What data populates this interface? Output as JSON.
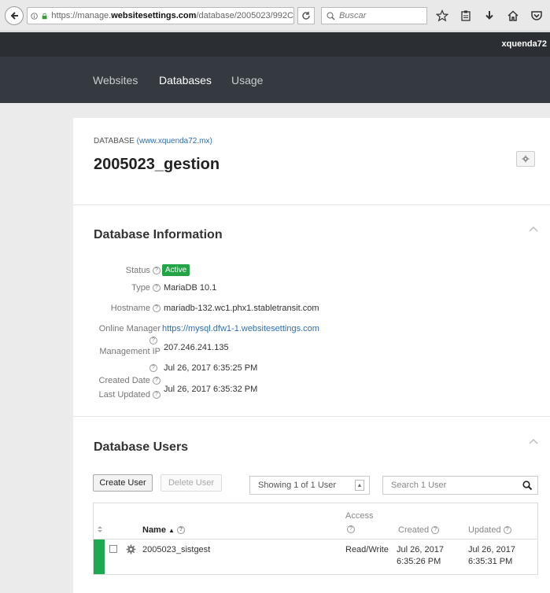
{
  "browser": {
    "url_prefix": "https://manage.",
    "url_domain": "websitesettings.com",
    "url_suffix": "/database/2005023/992C",
    "search_placeholder": "Buscar"
  },
  "header": {
    "username": "xquenda72",
    "nav": [
      "Websites",
      "Databases",
      "Usage"
    ],
    "active_nav": "Databases"
  },
  "database": {
    "eyebrow_label": "DATABASE",
    "eyebrow_domain": "(www.xquenda72.mx)",
    "name": "2005023_gestion"
  },
  "info": {
    "title": "Database Information",
    "status_label": "Status",
    "status_value": "Active",
    "type_label": "Type",
    "type_value": "MariaDB 10.1",
    "hostname_label": "Hostname",
    "hostname_value": "mariadb-132.wc1.phx1.stabletransit.com",
    "online_manager_label": "Online Manager",
    "online_manager_value": "https://mysql.dfw1-1.websitesettings.com",
    "management_ip_label": "Management IP",
    "management_ip_value": "207.246.241.135",
    "created_label": "Created Date",
    "created_value": "Jul 26, 2017 6:35:25 PM",
    "updated_label": "Last Updated",
    "updated_value": "Jul 26, 2017 6:35:32 PM"
  },
  "users": {
    "title": "Database Users",
    "create_button": "Create User",
    "delete_button": "Delete User",
    "showing": "Showing 1 of 1 User",
    "search_placeholder": "Search 1 User",
    "columns": {
      "name": "Name",
      "access": "Access",
      "created": "Created",
      "updated": "Updated"
    },
    "rows": [
      {
        "name": "2005023_sistgest",
        "access": "Read/Write",
        "created_line1": "Jul 26, 2017",
        "created_line2": "6:35:26 PM",
        "updated_line1": "Jul 26, 2017",
        "updated_line2": "6:35:31 PM"
      }
    ]
  },
  "colors": {
    "active_badge": "#22a447",
    "nav_bg": "#343a40",
    "link": "#2f6fb5",
    "row_status": "#1ea84f"
  }
}
